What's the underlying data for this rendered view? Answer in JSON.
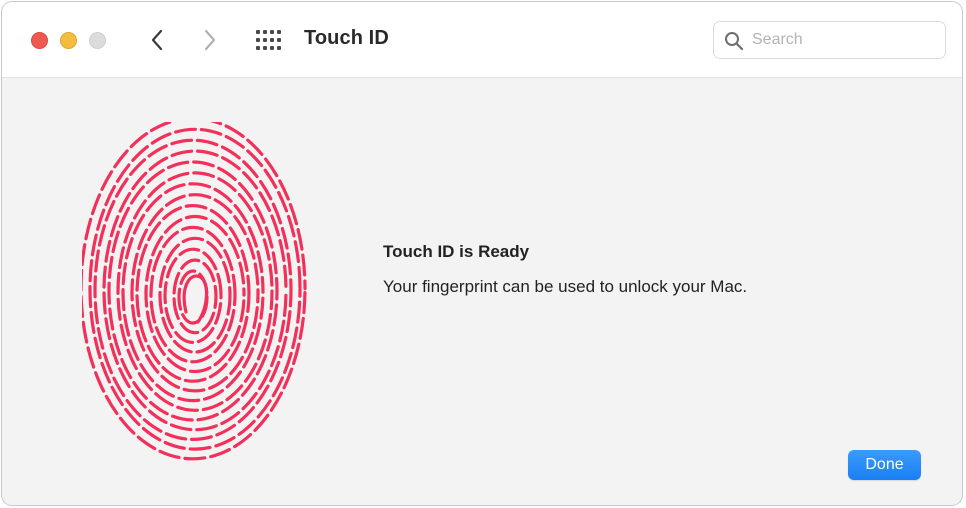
{
  "window": {
    "title": "Touch ID",
    "controls": {
      "close_color": "#ee5a52",
      "minimize_color": "#f4bd3f",
      "zoom_color": "#dcdcdc"
    }
  },
  "toolbar": {
    "back_icon": "chevron-left-icon",
    "forward_icon": "chevron-right-icon",
    "show_all_icon": "grid-icon"
  },
  "search": {
    "placeholder": "Search",
    "value": "",
    "icon": "search-icon"
  },
  "content": {
    "illustration_icon": "fingerprint-icon",
    "illustration_color": "#f2315a",
    "heading": "Touch ID is Ready",
    "message": "Your fingerprint can be used to unlock your Mac."
  },
  "actions": {
    "done_label": "Done",
    "accent_color": "#1a7ff4"
  }
}
